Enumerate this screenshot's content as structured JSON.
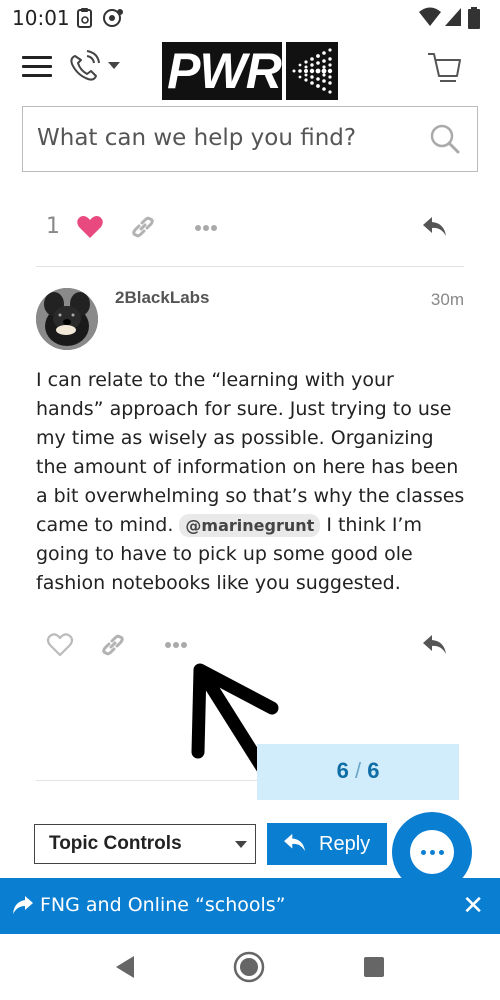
{
  "status_bar": {
    "time": "10:01",
    "icons": [
      "clipboard-sync-icon",
      "record-icon",
      "wifi-icon",
      "cell-signal-icon",
      "battery-icon"
    ]
  },
  "header": {
    "logo_text": "PWR",
    "icons": [
      "hamburger-icon",
      "phone-icon",
      "chevron-down-icon",
      "cart-icon"
    ]
  },
  "search": {
    "placeholder": "What can we help you find?"
  },
  "previous_post_actions": {
    "like_count": "1",
    "liked": true
  },
  "post": {
    "username": "2BlackLabs",
    "time": "30m",
    "body_before_mention": "I can relate to the “learning with your hands” approach for sure. Just trying to use my time as wisely as possible. Organizing the amount of information on here has been a bit overwhelming so that’s why the classes came to mind.",
    "mention": "@marinegrunt",
    "body_after_mention": "I think I’m going to have to pick up some good ole fashion notebooks like you suggested."
  },
  "progress": {
    "current": "6",
    "separator": "/",
    "total": "6"
  },
  "controls": {
    "topic_controls_label": "Topic Controls",
    "reply_label": "Reply"
  },
  "banner": {
    "topic_title": "FNG and Online “schools”"
  },
  "colors": {
    "accent": "#0a7ed1",
    "heart": "#e84a7f",
    "progress_bg": "#d1ecfa",
    "progress_text": "#0f6ea5"
  }
}
